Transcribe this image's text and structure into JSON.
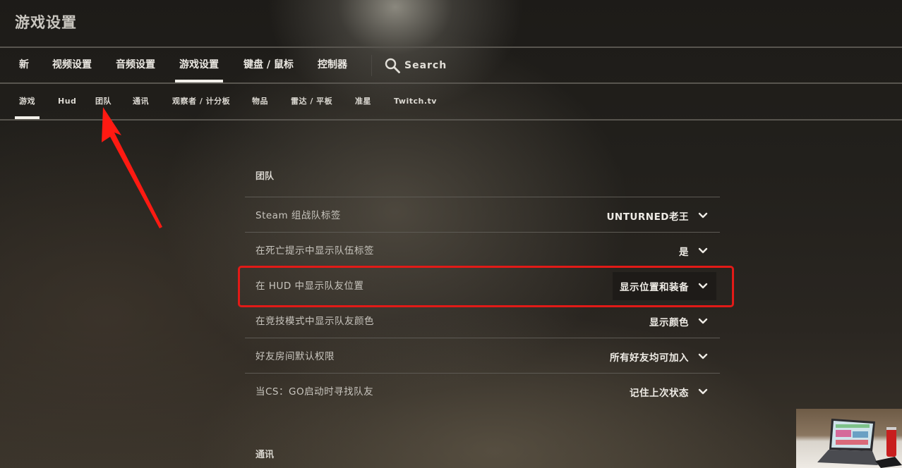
{
  "header": {
    "title": "游戏设置"
  },
  "main_tabs": [
    {
      "label": "新",
      "active": false
    },
    {
      "label": "视频设置",
      "active": false
    },
    {
      "label": "音频设置",
      "active": false
    },
    {
      "label": "游戏设置",
      "active": true
    },
    {
      "label": "键盘 / 鼠标",
      "active": false
    },
    {
      "label": "控制器",
      "active": false
    }
  ],
  "search": {
    "label": "Search",
    "icon": "search-icon"
  },
  "sub_tabs": [
    {
      "label": "游戏",
      "active": true
    },
    {
      "label": "Hud",
      "active": false
    },
    {
      "label": "团队",
      "active": false
    },
    {
      "label": "通讯",
      "active": false
    },
    {
      "label": "观察者 / 计分板",
      "active": false
    },
    {
      "label": "物品",
      "active": false
    },
    {
      "label": "雷达 / 平板",
      "active": false
    },
    {
      "label": "准星",
      "active": false
    },
    {
      "label": "Twitch.tv",
      "active": false
    }
  ],
  "sections": [
    {
      "heading": "团队",
      "settings": [
        {
          "label": "Steam 组战队标签",
          "value": "UNTURNED老王"
        },
        {
          "label": "在死亡提示中显示队伍标签",
          "value": "是"
        },
        {
          "label": "在 HUD 中显示队友位置",
          "value": "显示位置和装备",
          "highlighted": true
        },
        {
          "label": "在竞技模式中显示队友颜色",
          "value": "显示颜色"
        },
        {
          "label": "好友房间默认权限",
          "value": "所有好友均可加入"
        },
        {
          "label": "当CS：GO启动时寻找队友",
          "value": "记住上次状态"
        }
      ]
    },
    {
      "heading": "通讯",
      "settings": []
    }
  ],
  "annotations": {
    "highlight_color": "#e21a17",
    "arrow_color": "#ff1a12"
  },
  "colors": {
    "text_primary": "#efece6",
    "text_secondary": "#c8c5be",
    "divider": "#5d5a54",
    "underline_active": "#f2f0ea"
  }
}
